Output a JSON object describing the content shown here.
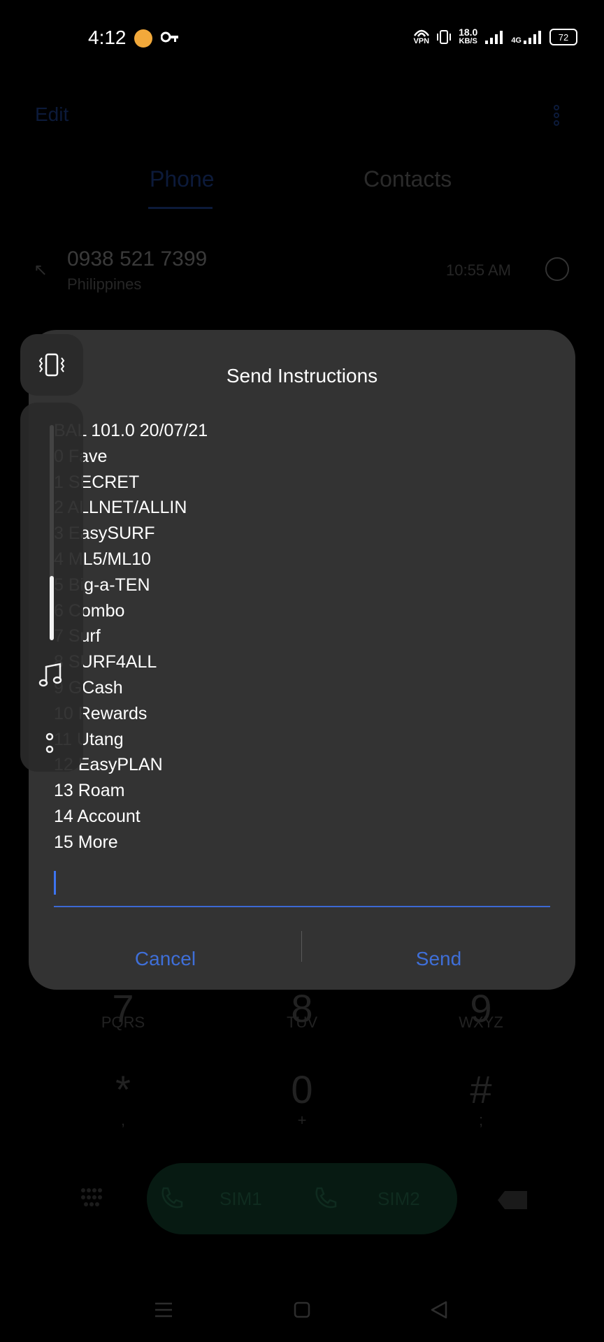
{
  "status_bar": {
    "time": "4:12",
    "vpn": "VPN",
    "network_speed": "18.0",
    "network_speed_unit": "KB/S",
    "signal_type": "4G",
    "battery": "72"
  },
  "background": {
    "edit_label": "Edit",
    "tabs": [
      "Phone",
      "Contacts"
    ],
    "recent_call": {
      "number": "0938 521 7399",
      "country": "Philippines",
      "time": "10:55 AM"
    },
    "keypad": [
      {
        "digit": "7",
        "letters": "PQRS"
      },
      {
        "digit": "8",
        "letters": "TUV"
      },
      {
        "digit": "9",
        "letters": "WXYZ"
      },
      {
        "digit": "*",
        "letters": ","
      },
      {
        "digit": "0",
        "letters": "+"
      },
      {
        "digit": "#",
        "letters": ";"
      }
    ],
    "sim1_label": "SIM1",
    "sim2_label": "SIM2"
  },
  "dialog": {
    "title": "Send Instructions",
    "lines": [
      "BAL 101.0 20/07/21",
      "0 Fave",
      "1 SECRET",
      "2 ALLNET/ALLIN",
      "3 EasySURF",
      "4 ML5/ML10",
      "5 Big-a-TEN",
      "6 Combo",
      "7 Surf",
      "8 SURF4ALL",
      "9 GCash",
      "10 Rewards",
      "11 Utang",
      "12 EasyPLAN",
      "13 Roam",
      "14 Account",
      "15 More"
    ],
    "input_value": "",
    "cancel_label": "Cancel",
    "send_label": "Send"
  },
  "volume_panel": {
    "level_fraction": 0.3
  },
  "colors": {
    "dialog_bg": "#333333",
    "accent_blue": "#3f6fd8",
    "call_bar_green": "#071a12"
  }
}
